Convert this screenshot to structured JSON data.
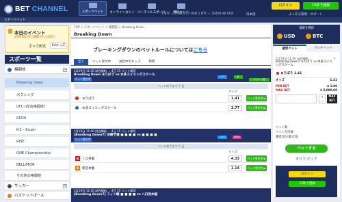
{
  "header": {
    "logo_text_1": "BET",
    "logo_text_2": "CHANNEL",
    "tabs": [
      {
        "label": "スポーツベット"
      },
      {
        "label": "オンラインカジノ"
      },
      {
        "label": "バーチャルスポーツ"
      },
      {
        "label": "無料カジノ"
      }
    ],
    "login_label": "ログイン",
    "signup_label": "15秒で登録",
    "rates": "1 BTC = 21815.57 USD   1 BTC = 20426.90 EUR",
    "language": "日本語",
    "help": "よくある質問・サポート"
  },
  "subheader": {
    "label": "スポーツベット"
  },
  "event": {
    "title": "本日のイベント",
    "subtitle": "(24時間以内に開催される試合)",
    "odds_label": "オッズ形式",
    "odds_value": "EUオッズ"
  },
  "sports": {
    "title": "スポーツ一覧",
    "category": "格闘技",
    "sub_items": [
      "Breaking Down",
      "ボクシング",
      "UFC (総合格闘技)",
      "RIZIN",
      "K-1・Krush",
      "RISE",
      "ONE Championship",
      "BELLATOR",
      "その他の格闘技"
    ],
    "next_category": "サッカー",
    "last_category": "バスケットボール"
  },
  "main": {
    "breadcrumb": "TOP > スポーツベット > 格闘技 > Breaking Down",
    "title": "Breaking Down",
    "notice_text": "ブレーキングダウンのベットルールについては",
    "notice_link": "こちら",
    "filter_tabs": [
      "全て",
      "ベット受付中",
      "試合中のオッズ",
      "特典"
    ],
    "matches": [
      {
        "date": "2月19日 11:00  試合開始 … 4日 15 ベット締切",
        "title": "Breaking Down   ぁりぼう  vs  水多スイミングスクール",
        "league": "ベット受付中",
        "status": "ベット終了まで 5 日",
        "odds_header": "オッズ",
        "live": "LIVE",
        "more": "ベット一覧",
        "selections": [
          {
            "name": "ぁりぼう",
            "odds": "1.41",
            "bet": "ベット受付中 ▶"
          },
          {
            "name": "水多スイミングスクール",
            "odds": "2.77",
            "bet": "ベット受付中 ▶"
          }
        ]
      },
      {
        "date": "2月19日 11:00  試合開始 … 4日 15 ベット締切",
        "title": "[Breaking Down7] 決勝予選   ■ ■ ■ ■  vs  ■ ■ ■ ■",
        "league": "ベット受付中",
        "status": "ベット終了まで 5 日",
        "odds_header": "オッズ",
        "live": "LIVE",
        "new_tag": "NEW",
        "selections": [
          {
            "name": "ｒ口井着",
            "odds": "4.33",
            "bet": "ベット受付中 ▶"
          },
          {
            "name": "新宮井着",
            "odds": "1.14",
            "bet": "ベット受付中 ▶"
          }
        ]
      },
      {
        "date": "2月19日 11:00  試合開始 … 4日 15 ベット締切",
        "title": "[Breaking Down7] フィン戦   ■ ■ ■ ■  vs  ハ口見木誠"
      }
    ]
  },
  "betslip": {
    "currency_title": "通貨を選択",
    "usd": "USD",
    "btc": "BTC",
    "tab_single": "通常ベット",
    "tab_multi": "マルチベット",
    "date": "2月19日 11:00  試合開始",
    "match": "Breaking Down7   ぁりぼう  vs  水多スイミングスクール",
    "pick": "ぁりぼう  1.41",
    "odds_label": "オッズ",
    "odds_value": "1.41",
    "min_bet_label": "MIN BET",
    "min_bet_value": "$ 1.00",
    "max_bet_label": "MAX BET",
    "max_bet_value": "$ 5,000.00",
    "plus": "+",
    "minus": "−",
    "max_label": "MAX BET",
    "sum_1": "ベット数",
    "sum_2": "ベット合計額",
    "sum_3": "獲得合計(最大時)",
    "place_label": "ベットする",
    "clear_label": "すべてクリア",
    "login_label": "ログイン",
    "signup_label": "15秒で登録"
  }
}
